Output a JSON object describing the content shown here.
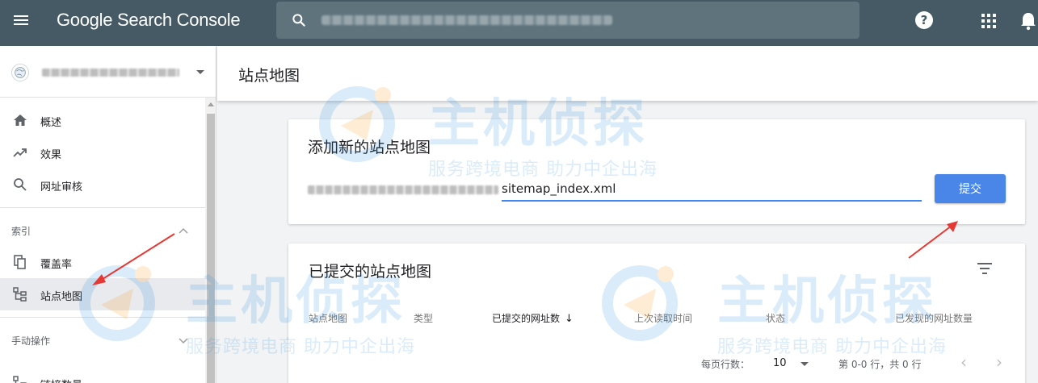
{
  "app": {
    "logo_text": "Google Search Console"
  },
  "header": {
    "search": {
      "value": "",
      "placeholder": ""
    },
    "help_glyph": "?"
  },
  "sidebar": {
    "nav": [
      {
        "label": "概述",
        "icon": "home-icon"
      },
      {
        "label": "效果",
        "icon": "trending-up-icon"
      },
      {
        "label": "网址审核",
        "icon": "search-icon"
      }
    ],
    "sections": [
      {
        "label": "索引",
        "items": [
          {
            "label": "覆盖率",
            "icon": "copy-icon"
          },
          {
            "label": "站点地图",
            "icon": "sitemap-icon",
            "active": true
          }
        ]
      },
      {
        "label": "手动操作",
        "items": [
          {
            "label": "链接数量",
            "icon": "links-icon"
          }
        ]
      }
    ]
  },
  "page": {
    "title": "站点地图"
  },
  "add_card": {
    "title": "添加新的站点地图",
    "input_value": "sitemap_index.xml",
    "submit_label": "提交"
  },
  "list_card": {
    "title": "已提交的站点地图",
    "columns": [
      "站点地图",
      "类型",
      "已提交的网址数",
      "上次读取时间",
      "状态",
      "已发现的网址数量"
    ],
    "sorted_arrow": "↓",
    "rows_per_page_label": "每页行数：",
    "rows_per_page_value": "10",
    "range_text": "第 0-0 行，共 0 行"
  },
  "watermark": {
    "main": "主机侦探",
    "sub": "服务跨境电商 助力中企出海"
  },
  "colors": {
    "header_bg": "#455a64",
    "accent": "#4a86e8",
    "arrow": "#e53935",
    "watermark": "#1e88e5"
  }
}
